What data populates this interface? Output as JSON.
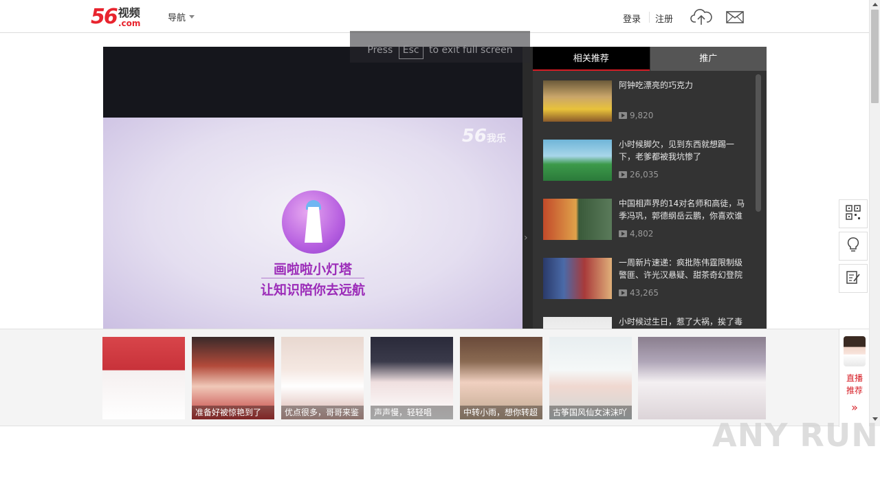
{
  "header": {
    "logo_num": "56",
    "logo_cn": "视频",
    "logo_com": ".com",
    "nav_label": "导航",
    "login_label": "登录",
    "register_label": "注册",
    "upload_icon": "cloud-upload-icon",
    "mail_icon": "mail-icon"
  },
  "fullscreen_notice": {
    "press": "Press",
    "key": "Esc",
    "rest": "to exit full screen"
  },
  "video": {
    "watermark_num": "56",
    "watermark_cn": "我乐",
    "brand_line1": "画啦啦小灯塔",
    "brand_line2": "让知识陪你去远航"
  },
  "panel": {
    "tabs": [
      {
        "label": "相关推荐",
        "active": true
      },
      {
        "label": "推广",
        "active": false
      }
    ],
    "items": [
      {
        "title": "阿钟吃漂亮的巧克力",
        "views": "9,820"
      },
      {
        "title": "小时候脚欠，见到东西就想踢一下，老爹都被我坑惨了",
        "views": "26,035"
      },
      {
        "title": "中国相声界的14对名师和高徒，马季冯巩，郭德纲岳云鹏，你喜欢谁",
        "views": "4,802"
      },
      {
        "title": "一周新片速递：疯批陈伟霆限制级警匪、许光汉悬疑、甜茶奇幻登院",
        "views": "43,265"
      },
      {
        "title": "小时候过生日，惹了大祸，挨了毒打",
        "views": ""
      }
    ]
  },
  "side_tools": [
    "qr-code-icon",
    "lightbulb-icon",
    "edit-note-icon"
  ],
  "live": {
    "cards": [
      {
        "caption": ""
      },
      {
        "caption": "准备好被惊艳到了"
      },
      {
        "caption": "优点很多，哥哥来鉴"
      },
      {
        "caption": "声声慢，轻轻唱"
      },
      {
        "caption": "中转小雨，想你转超"
      },
      {
        "caption": "古筝国风仙女沫沫吖"
      },
      {
        "caption": ""
      }
    ],
    "side_label_1": "直播",
    "side_label_2": "推荐",
    "more": "»"
  },
  "watermark_text": "ANY RUN"
}
